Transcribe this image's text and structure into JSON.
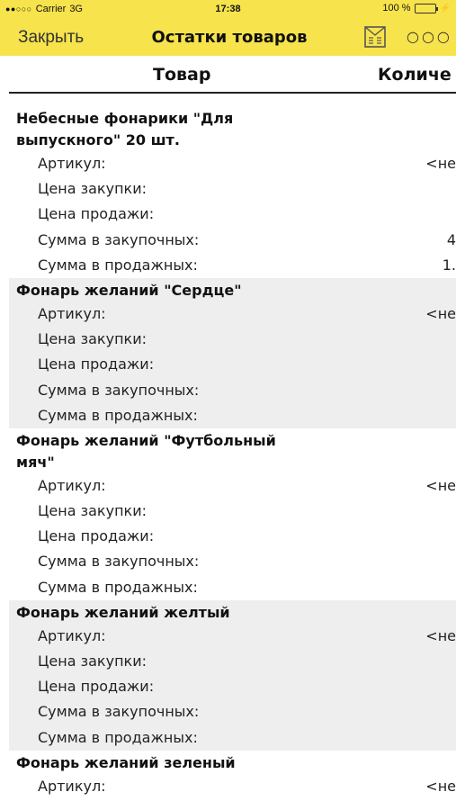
{
  "status": {
    "carrier": "Carrier",
    "network": "3G",
    "time": "17:38",
    "battery": "100 %"
  },
  "nav": {
    "close": "Закрыть",
    "title": "Остатки товаров",
    "more": "○○○"
  },
  "header": {
    "product": "Товар",
    "quantity": "Количе"
  },
  "groups": [
    {
      "title": "Небесные фонарики \"Для выпускного\" 20 шт.",
      "rows": [
        {
          "label": "Артикул:",
          "value": "<не"
        },
        {
          "label": "Цена закупки:",
          "value": ""
        },
        {
          "label": "Цена продажи:",
          "value": ""
        },
        {
          "label": "Сумма в закупочных:",
          "value": "4"
        },
        {
          "label": "Сумма в продажных:",
          "value": "1."
        }
      ]
    },
    {
      "title": "Фонарь желаний \"Сердце\"",
      "rows": [
        {
          "label": "Артикул:",
          "value": "<не"
        },
        {
          "label": "Цена закупки:",
          "value": ""
        },
        {
          "label": "Цена продажи:",
          "value": ""
        },
        {
          "label": "Сумма в закупочных:",
          "value": ""
        },
        {
          "label": "Сумма в продажных:",
          "value": ""
        }
      ]
    },
    {
      "title": "Фонарь желаний \"Футбольный мяч\"",
      "rows": [
        {
          "label": "Артикул:",
          "value": "<не"
        },
        {
          "label": "Цена закупки:",
          "value": ""
        },
        {
          "label": "Цена продажи:",
          "value": ""
        },
        {
          "label": "Сумма в закупочных:",
          "value": ""
        },
        {
          "label": "Сумма в продажных:",
          "value": ""
        }
      ]
    },
    {
      "title": "Фонарь желаний желтый",
      "rows": [
        {
          "label": "Артикул:",
          "value": "<не"
        },
        {
          "label": "Цена закупки:",
          "value": ""
        },
        {
          "label": "Цена продажи:",
          "value": ""
        },
        {
          "label": "Сумма в закупочных:",
          "value": ""
        },
        {
          "label": "Сумма в продажных:",
          "value": ""
        }
      ]
    },
    {
      "title": "Фонарь желаний зеленый",
      "rows": [
        {
          "label": "Артикул:",
          "value": "<не"
        }
      ]
    }
  ],
  "icons": {
    "signal": "signal-dots-icon",
    "battery": "battery-icon",
    "charging": "charging-bolt-icon",
    "report": "report-icon",
    "more": "more-icon"
  },
  "colors": {
    "bar": "#f7e34b",
    "battery_fill": "#4cd964",
    "shade": "#eeeeee"
  }
}
